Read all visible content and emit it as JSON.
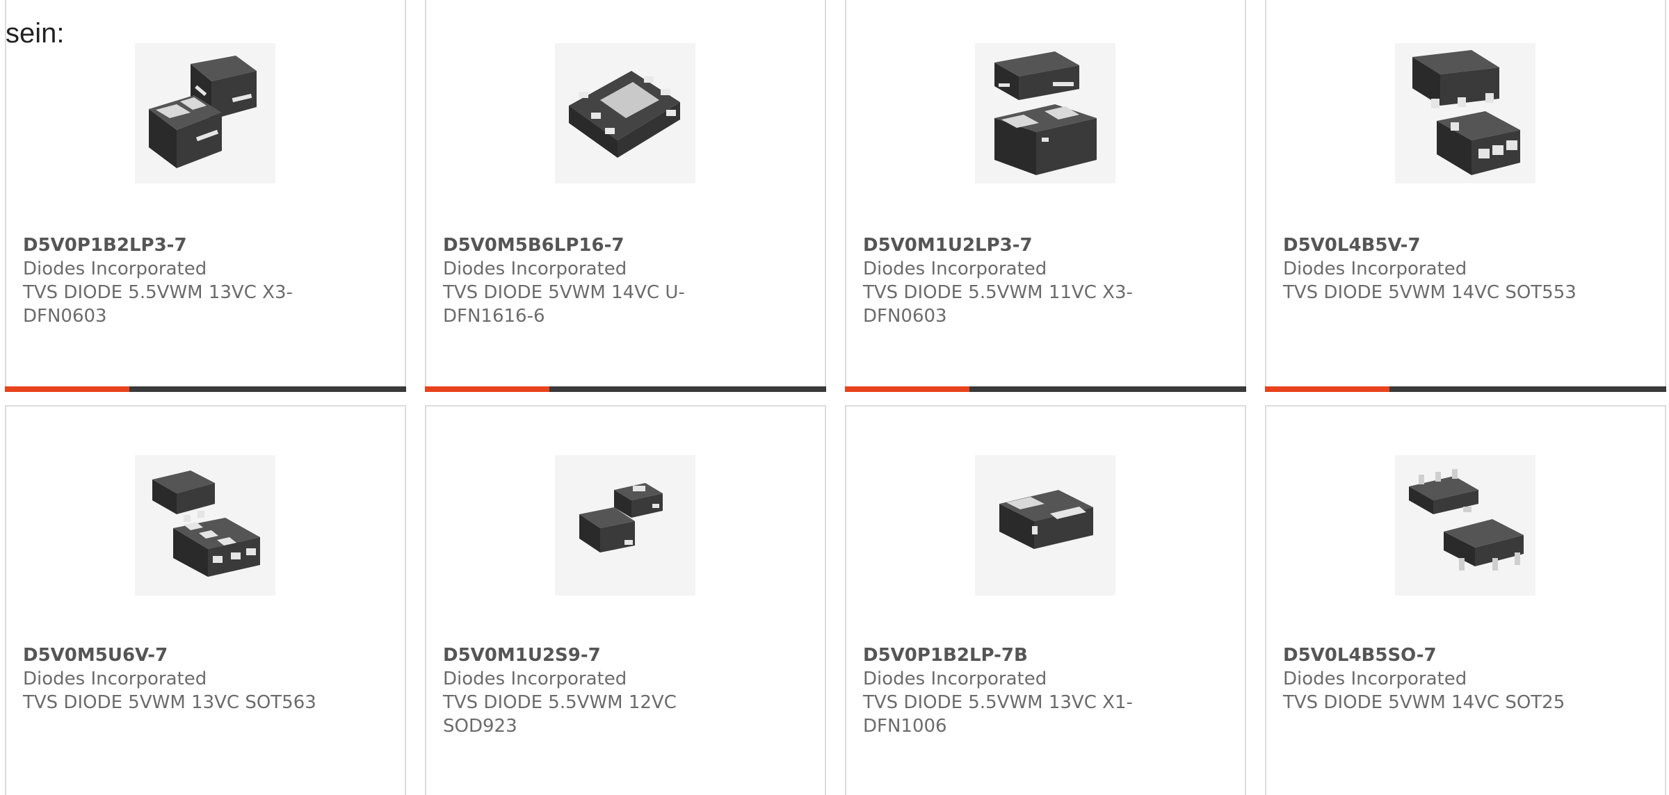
{
  "intro_text": "sein:",
  "accent_color": "#e8431c",
  "bar_color": "#3a3a3a",
  "products": [
    {
      "part": "D5V0P1B2LP3-7",
      "manufacturer": "Diodes Incorporated",
      "description": "TVS DIODE 5.5VWM 13VC X3-DFN0603",
      "image_icon": "x3-dfn0603-chip-icon",
      "progress": 0.31
    },
    {
      "part": "D5V0M5B6LP16-7",
      "manufacturer": "Diodes Incorporated",
      "description": "TVS DIODE 5VWM 14VC U-DFN1616-6",
      "image_icon": "u-dfn1616-chip-icon",
      "progress": 0.31
    },
    {
      "part": "D5V0M1U2LP3-7",
      "manufacturer": "Diodes Incorporated",
      "description": "TVS DIODE 5.5VWM 11VC X3-DFN0603",
      "image_icon": "x3-dfn0603-chip-icon",
      "progress": 0.31
    },
    {
      "part": "D5V0L4B5V-7",
      "manufacturer": "Diodes Incorporated",
      "description": "TVS DIODE 5VWM 14VC SOT553",
      "image_icon": "sot553-chip-icon",
      "progress": 0.31
    },
    {
      "part": "D5V0M5U6V-7",
      "manufacturer": "Diodes Incorporated",
      "description": "TVS DIODE 5VWM 13VC SOT563",
      "image_icon": "sot563-chip-icon"
    },
    {
      "part": "D5V0M1U2S9-7",
      "manufacturer": "Diodes Incorporated",
      "description": "TVS DIODE 5.5VWM 12VC SOD923",
      "image_icon": "sod923-chip-icon"
    },
    {
      "part": "D5V0P1B2LP-7B",
      "manufacturer": "Diodes Incorporated",
      "description": "TVS DIODE 5.5VWM 13VC X1-DFN1006",
      "image_icon": "x1-dfn1006-chip-icon"
    },
    {
      "part": "D5V0L4B5SO-7",
      "manufacturer": "Diodes Incorporated",
      "description": "TVS DIODE 5VWM 14VC SOT25",
      "image_icon": "sot25-chip-icon"
    }
  ]
}
